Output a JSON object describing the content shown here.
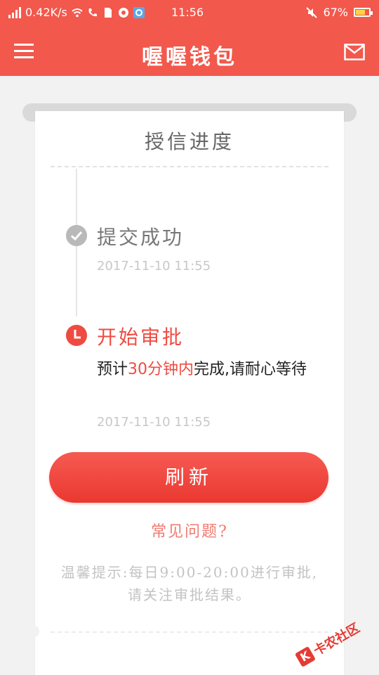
{
  "status_bar": {
    "network_speed": "0.42K/s",
    "time": "11:56",
    "battery": "67%",
    "battery_level": 0.67
  },
  "app_bar": {
    "title": "喔喔钱包",
    "menu_icon": "hamburger-menu-icon",
    "mail_icon": "mail-icon"
  },
  "card": {
    "title": "授信进度",
    "steps": [
      {
        "title": "提交成功",
        "time": "2017-11-10 11:55",
        "status": "done",
        "icon": "check-circle-icon",
        "color": "#b9b9b9"
      },
      {
        "title": "开始审批",
        "desc_prefix": "预计",
        "desc_highlight": "30分钟内",
        "desc_suffix": "完成,请耐心等待",
        "time": "2017-11-10 11:55",
        "status": "active",
        "icon": "clock-circle-icon",
        "color": "#ef4b42"
      }
    ],
    "refresh_label": "刷新",
    "faq_label": "常见问题?",
    "tip_line1": "温馨提示:每日9:00-20:00进行审批,",
    "tip_line2": "请关注审批结果。"
  },
  "watermark": {
    "text": "卡农社区",
    "logo_text": "K"
  },
  "colors": {
    "brand": "#f2584c",
    "accent": "#ef4b42",
    "link": "#f07a70"
  }
}
